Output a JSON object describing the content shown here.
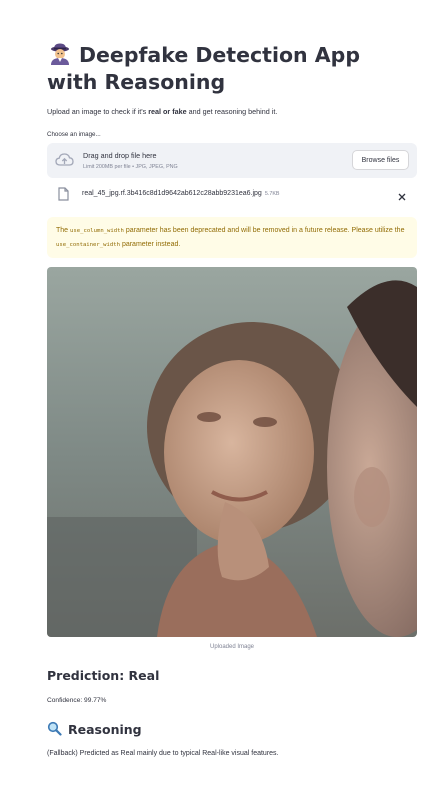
{
  "app": {
    "title": "Deepfake Detection App with Reasoning",
    "title_icon": "detective-emoji",
    "intro_before": "Upload an image to check if it's ",
    "intro_bold": "real or fake",
    "intro_after": " and get reasoning behind it."
  },
  "uploader": {
    "label": "Choose an image...",
    "drop_title": "Drag and drop file here",
    "drop_limit": "Limit 200MB per file • JPG, JPEG, PNG",
    "browse_label": "Browse files",
    "icon": "cloud-upload-icon"
  },
  "file": {
    "name": "real_45_jpg.rf.3b416c8d1d9642ab612c28abb9231ea6.jpg",
    "size": "5.7KB",
    "icon": "file-icon",
    "close_icon": "close-icon"
  },
  "warning": {
    "t1": "The ",
    "code1": "use_column_width",
    "t2": " parameter has been deprecated and will be removed in a future release. Please utilize the ",
    "code2": "use_container_width",
    "t3": " parameter instead."
  },
  "image": {
    "caption": "Uploaded Image"
  },
  "result": {
    "prediction": "Prediction: Real",
    "confidence": "Confidence: 99.77%",
    "reasoning_heading": "Reasoning",
    "reasoning_icon": "magnifier-emoji",
    "reasoning_text": "(Fallback) Predicted as Real mainly due to typical Real-like visual features."
  },
  "colors": {
    "text": "#31333f",
    "muted": "#808495",
    "dropzone_bg": "#f0f2f6",
    "warning_bg": "#fffce7",
    "warning_text": "#926c05"
  }
}
